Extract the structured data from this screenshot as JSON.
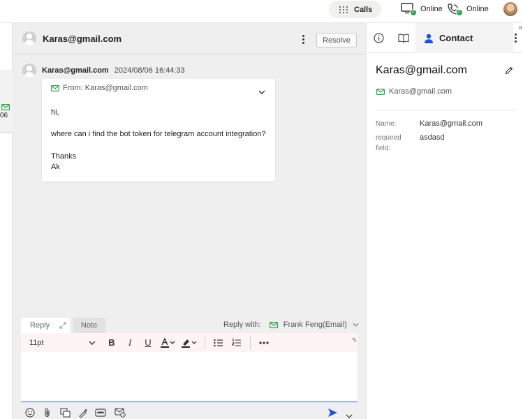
{
  "topbar": {
    "calls_label": "Calls",
    "status1_label": "Online",
    "status2_label": "Online",
    "icons": [
      "dialpad-icon",
      "monitor-icon",
      "phone-icon",
      "user-avatar"
    ]
  },
  "left_list": {
    "partial_text": "06"
  },
  "conversation": {
    "title": "Karas@gmail.com",
    "resolve_label": "Resolve",
    "message": {
      "sender": "Karas@gmail.com",
      "timestamp": "2024/08/06 16:44:33",
      "from_line": "From: Karas@gmail.com",
      "body": [
        "hi,",
        "",
        "where can i find the bot token for telegram account integration?",
        "",
        "Thanks",
        "Ak"
      ]
    }
  },
  "reply": {
    "tab_reply": "Reply",
    "tab_note": "Note",
    "reply_with_label": "Reply with:",
    "reply_with_value": "Frank Feng(Email)",
    "font_size": "11pt"
  },
  "contact": {
    "tab_label": "Contact",
    "name": "Karas@gmail.com",
    "email": "Karas@gmail.com",
    "fields": [
      {
        "label": "Name:",
        "value": "Karas@gmail.com"
      },
      {
        "label": "required field:",
        "value": "asdasd"
      }
    ]
  },
  "colors": {
    "accent_blue": "#2f5fd8",
    "online_green": "#2ea24a",
    "mail_green": "#2ea24a",
    "contact_blue": "#1f52d8"
  }
}
